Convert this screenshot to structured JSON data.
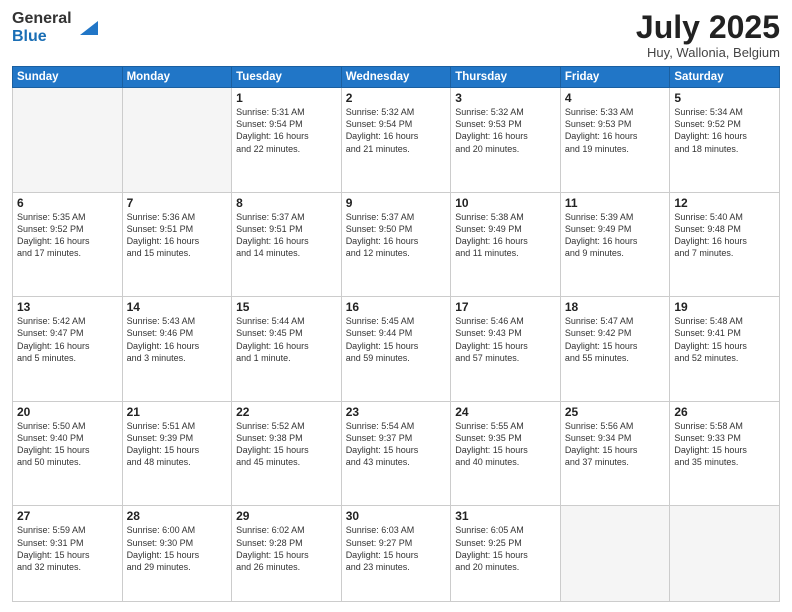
{
  "logo": {
    "general": "General",
    "blue": "Blue"
  },
  "title": "July 2025",
  "location": "Huy, Wallonia, Belgium",
  "days_of_week": [
    "Sunday",
    "Monday",
    "Tuesday",
    "Wednesday",
    "Thursday",
    "Friday",
    "Saturday"
  ],
  "weeks": [
    [
      {
        "day": "",
        "lines": []
      },
      {
        "day": "",
        "lines": []
      },
      {
        "day": "1",
        "lines": [
          "Sunrise: 5:31 AM",
          "Sunset: 9:54 PM",
          "Daylight: 16 hours",
          "and 22 minutes."
        ]
      },
      {
        "day": "2",
        "lines": [
          "Sunrise: 5:32 AM",
          "Sunset: 9:54 PM",
          "Daylight: 16 hours",
          "and 21 minutes."
        ]
      },
      {
        "day": "3",
        "lines": [
          "Sunrise: 5:32 AM",
          "Sunset: 9:53 PM",
          "Daylight: 16 hours",
          "and 20 minutes."
        ]
      },
      {
        "day": "4",
        "lines": [
          "Sunrise: 5:33 AM",
          "Sunset: 9:53 PM",
          "Daylight: 16 hours",
          "and 19 minutes."
        ]
      },
      {
        "day": "5",
        "lines": [
          "Sunrise: 5:34 AM",
          "Sunset: 9:52 PM",
          "Daylight: 16 hours",
          "and 18 minutes."
        ]
      }
    ],
    [
      {
        "day": "6",
        "lines": [
          "Sunrise: 5:35 AM",
          "Sunset: 9:52 PM",
          "Daylight: 16 hours",
          "and 17 minutes."
        ]
      },
      {
        "day": "7",
        "lines": [
          "Sunrise: 5:36 AM",
          "Sunset: 9:51 PM",
          "Daylight: 16 hours",
          "and 15 minutes."
        ]
      },
      {
        "day": "8",
        "lines": [
          "Sunrise: 5:37 AM",
          "Sunset: 9:51 PM",
          "Daylight: 16 hours",
          "and 14 minutes."
        ]
      },
      {
        "day": "9",
        "lines": [
          "Sunrise: 5:37 AM",
          "Sunset: 9:50 PM",
          "Daylight: 16 hours",
          "and 12 minutes."
        ]
      },
      {
        "day": "10",
        "lines": [
          "Sunrise: 5:38 AM",
          "Sunset: 9:49 PM",
          "Daylight: 16 hours",
          "and 11 minutes."
        ]
      },
      {
        "day": "11",
        "lines": [
          "Sunrise: 5:39 AM",
          "Sunset: 9:49 PM",
          "Daylight: 16 hours",
          "and 9 minutes."
        ]
      },
      {
        "day": "12",
        "lines": [
          "Sunrise: 5:40 AM",
          "Sunset: 9:48 PM",
          "Daylight: 16 hours",
          "and 7 minutes."
        ]
      }
    ],
    [
      {
        "day": "13",
        "lines": [
          "Sunrise: 5:42 AM",
          "Sunset: 9:47 PM",
          "Daylight: 16 hours",
          "and 5 minutes."
        ]
      },
      {
        "day": "14",
        "lines": [
          "Sunrise: 5:43 AM",
          "Sunset: 9:46 PM",
          "Daylight: 16 hours",
          "and 3 minutes."
        ]
      },
      {
        "day": "15",
        "lines": [
          "Sunrise: 5:44 AM",
          "Sunset: 9:45 PM",
          "Daylight: 16 hours",
          "and 1 minute."
        ]
      },
      {
        "day": "16",
        "lines": [
          "Sunrise: 5:45 AM",
          "Sunset: 9:44 PM",
          "Daylight: 15 hours",
          "and 59 minutes."
        ]
      },
      {
        "day": "17",
        "lines": [
          "Sunrise: 5:46 AM",
          "Sunset: 9:43 PM",
          "Daylight: 15 hours",
          "and 57 minutes."
        ]
      },
      {
        "day": "18",
        "lines": [
          "Sunrise: 5:47 AM",
          "Sunset: 9:42 PM",
          "Daylight: 15 hours",
          "and 55 minutes."
        ]
      },
      {
        "day": "19",
        "lines": [
          "Sunrise: 5:48 AM",
          "Sunset: 9:41 PM",
          "Daylight: 15 hours",
          "and 52 minutes."
        ]
      }
    ],
    [
      {
        "day": "20",
        "lines": [
          "Sunrise: 5:50 AM",
          "Sunset: 9:40 PM",
          "Daylight: 15 hours",
          "and 50 minutes."
        ]
      },
      {
        "day": "21",
        "lines": [
          "Sunrise: 5:51 AM",
          "Sunset: 9:39 PM",
          "Daylight: 15 hours",
          "and 48 minutes."
        ]
      },
      {
        "day": "22",
        "lines": [
          "Sunrise: 5:52 AM",
          "Sunset: 9:38 PM",
          "Daylight: 15 hours",
          "and 45 minutes."
        ]
      },
      {
        "day": "23",
        "lines": [
          "Sunrise: 5:54 AM",
          "Sunset: 9:37 PM",
          "Daylight: 15 hours",
          "and 43 minutes."
        ]
      },
      {
        "day": "24",
        "lines": [
          "Sunrise: 5:55 AM",
          "Sunset: 9:35 PM",
          "Daylight: 15 hours",
          "and 40 minutes."
        ]
      },
      {
        "day": "25",
        "lines": [
          "Sunrise: 5:56 AM",
          "Sunset: 9:34 PM",
          "Daylight: 15 hours",
          "and 37 minutes."
        ]
      },
      {
        "day": "26",
        "lines": [
          "Sunrise: 5:58 AM",
          "Sunset: 9:33 PM",
          "Daylight: 15 hours",
          "and 35 minutes."
        ]
      }
    ],
    [
      {
        "day": "27",
        "lines": [
          "Sunrise: 5:59 AM",
          "Sunset: 9:31 PM",
          "Daylight: 15 hours",
          "and 32 minutes."
        ]
      },
      {
        "day": "28",
        "lines": [
          "Sunrise: 6:00 AM",
          "Sunset: 9:30 PM",
          "Daylight: 15 hours",
          "and 29 minutes."
        ]
      },
      {
        "day": "29",
        "lines": [
          "Sunrise: 6:02 AM",
          "Sunset: 9:28 PM",
          "Daylight: 15 hours",
          "and 26 minutes."
        ]
      },
      {
        "day": "30",
        "lines": [
          "Sunrise: 6:03 AM",
          "Sunset: 9:27 PM",
          "Daylight: 15 hours",
          "and 23 minutes."
        ]
      },
      {
        "day": "31",
        "lines": [
          "Sunrise: 6:05 AM",
          "Sunset: 9:25 PM",
          "Daylight: 15 hours",
          "and 20 minutes."
        ]
      },
      {
        "day": "",
        "lines": []
      },
      {
        "day": "",
        "lines": []
      }
    ]
  ]
}
